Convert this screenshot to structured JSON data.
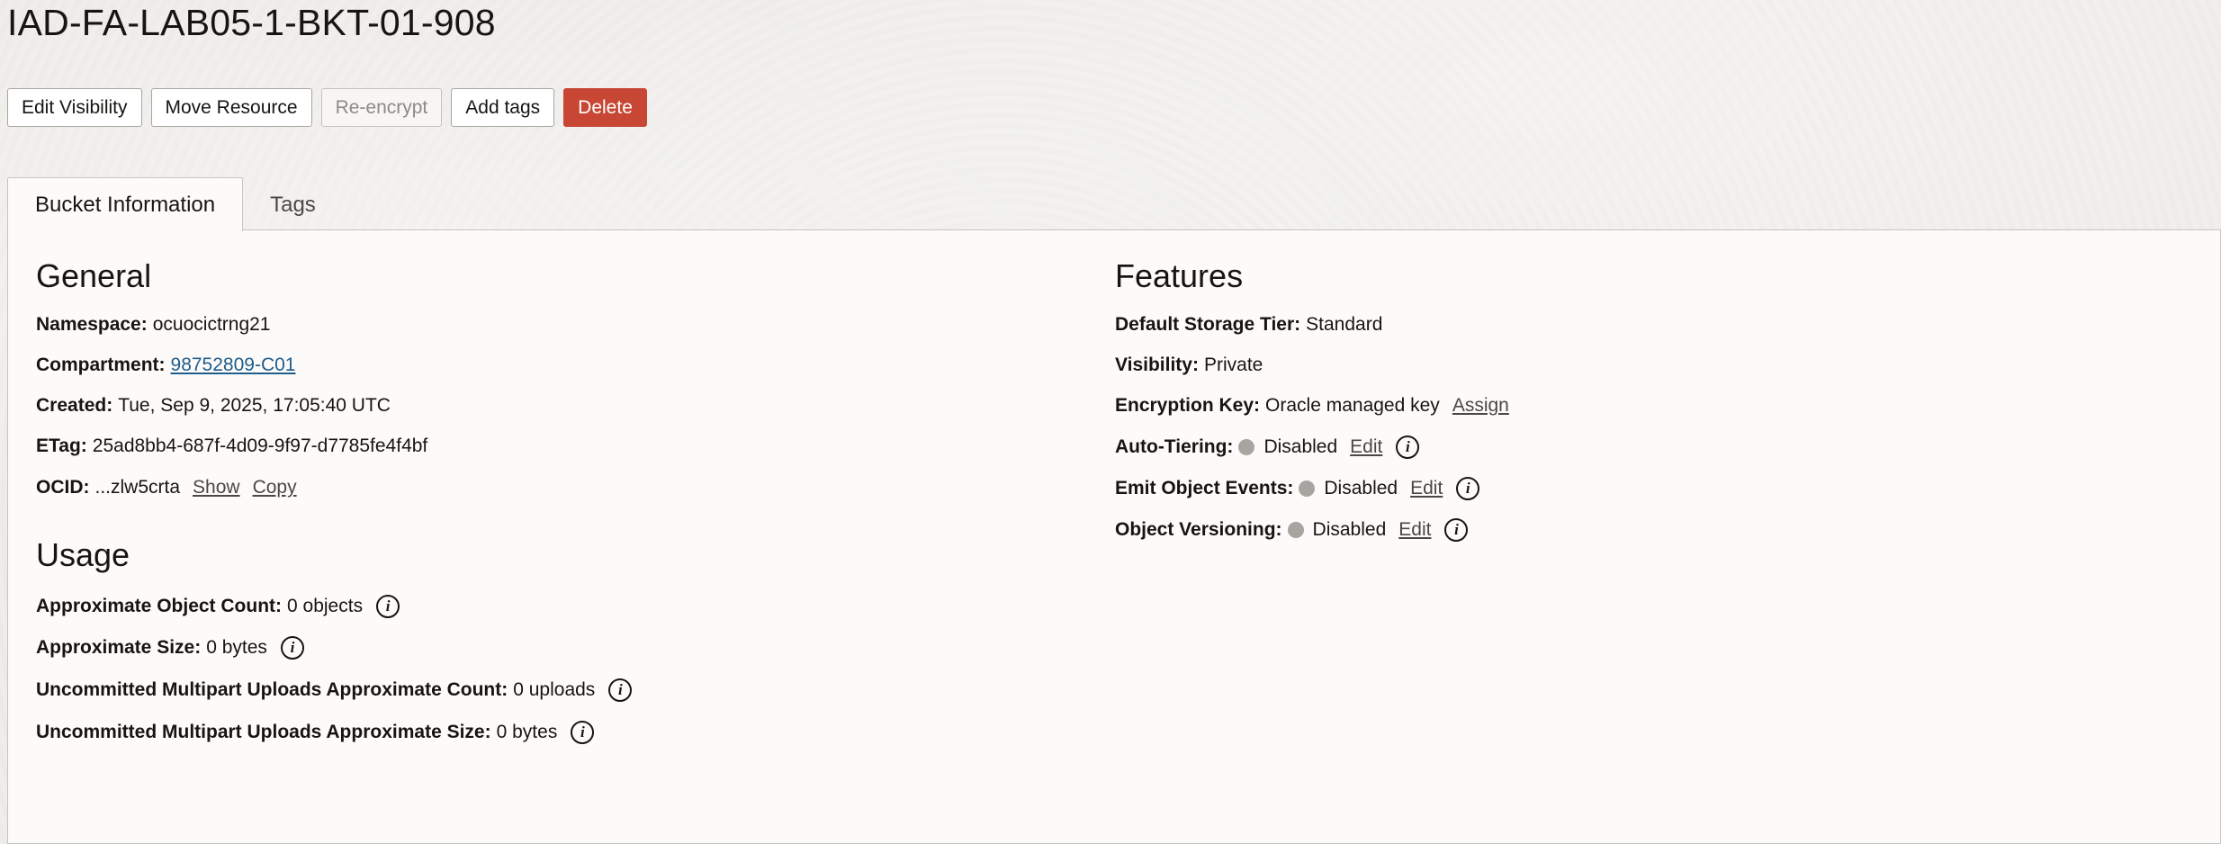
{
  "page": {
    "title": "IAD-FA-LAB05-1-BKT-01-908"
  },
  "toolbar": {
    "edit_visibility": "Edit Visibility",
    "move_resource": "Move Resource",
    "re_encrypt": "Re-encrypt",
    "add_tags": "Add tags",
    "delete": "Delete"
  },
  "tabs": [
    {
      "label": "Bucket Information",
      "active": true
    },
    {
      "label": "Tags",
      "active": false
    }
  ],
  "general": {
    "heading": "General",
    "namespace": {
      "label": "Namespace:",
      "value": "ocuocictrng21"
    },
    "compartment": {
      "label": "Compartment:",
      "value": "98752809-C01"
    },
    "created": {
      "label": "Created:",
      "value": "Tue, Sep 9, 2025, 17:05:40 UTC"
    },
    "etag": {
      "label": "ETag:",
      "value": "25ad8bb4-687f-4d09-9f97-d7785fe4f4bf"
    },
    "ocid": {
      "label": "OCID:",
      "value": "...zlw5crta",
      "show": "Show",
      "copy": "Copy"
    }
  },
  "usage": {
    "heading": "Usage",
    "object_count": {
      "label": "Approximate Object Count:",
      "value": "0 objects"
    },
    "size": {
      "label": "Approximate Size:",
      "value": "0 bytes"
    },
    "multipart_count": {
      "label": "Uncommitted Multipart Uploads Approximate Count:",
      "value": "0 uploads"
    },
    "multipart_size": {
      "label": "Uncommitted Multipart Uploads Approximate Size:",
      "value": "0 bytes"
    }
  },
  "features": {
    "heading": "Features",
    "storage_tier": {
      "label": "Default Storage Tier:",
      "value": "Standard"
    },
    "visibility": {
      "label": "Visibility:",
      "value": "Private"
    },
    "encryption": {
      "label": "Encryption Key:",
      "value": "Oracle managed key",
      "action": "Assign"
    },
    "auto_tiering": {
      "label": "Auto-Tiering:",
      "value": "Disabled",
      "action": "Edit"
    },
    "object_events": {
      "label": "Emit Object Events:",
      "value": "Disabled",
      "action": "Edit"
    },
    "versioning": {
      "label": "Object Versioning:",
      "value": "Disabled",
      "action": "Edit"
    }
  },
  "icons": {
    "info": "info-icon",
    "status": "status-dot-icon"
  },
  "colors": {
    "danger": "#c74634",
    "link": "#1f5c8b",
    "status_disabled": "#a8a5a1"
  }
}
